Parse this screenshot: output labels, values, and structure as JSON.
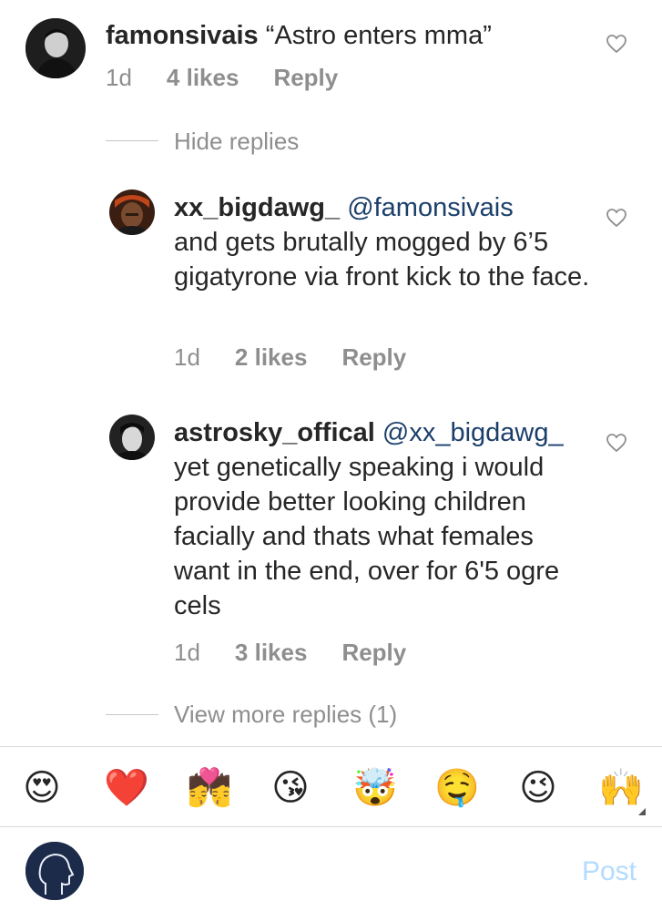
{
  "comments": [
    {
      "username": "famonsivais",
      "mention": "",
      "text": " “Astro enters mma”",
      "time": "1d",
      "likes": "4 likes",
      "reply": "Reply"
    },
    {
      "username": "xx_bigdawg_",
      "mention": "@famonsivais",
      "text": "and gets brutally mogged by 6’5 gigatyrone via front kick to the face.",
      "time": "1d",
      "likes": "2 likes",
      "reply": "Reply"
    },
    {
      "username": "astrosky_offical",
      "mention": "@xx_bigdawg_",
      "text": "yet genetically speaking i would provide better looking children facially and thats what females want in the end, over for 6'5 ogre cels",
      "time": "1d",
      "likes": "3 likes",
      "reply": "Reply"
    }
  ],
  "thread": {
    "hide_replies": "Hide replies",
    "view_more": "View more replies (1)"
  },
  "emoji_bar": [
    "😍",
    "❤️",
    "💏",
    "😘",
    "🤯",
    "🤤",
    "😉",
    "🙌"
  ],
  "composer": {
    "placeholder": "",
    "post_label": "Post"
  },
  "colors": {
    "mention": "#1b3f6b",
    "muted": "#8e8e8e",
    "post_disabled": "#b3dbff"
  }
}
